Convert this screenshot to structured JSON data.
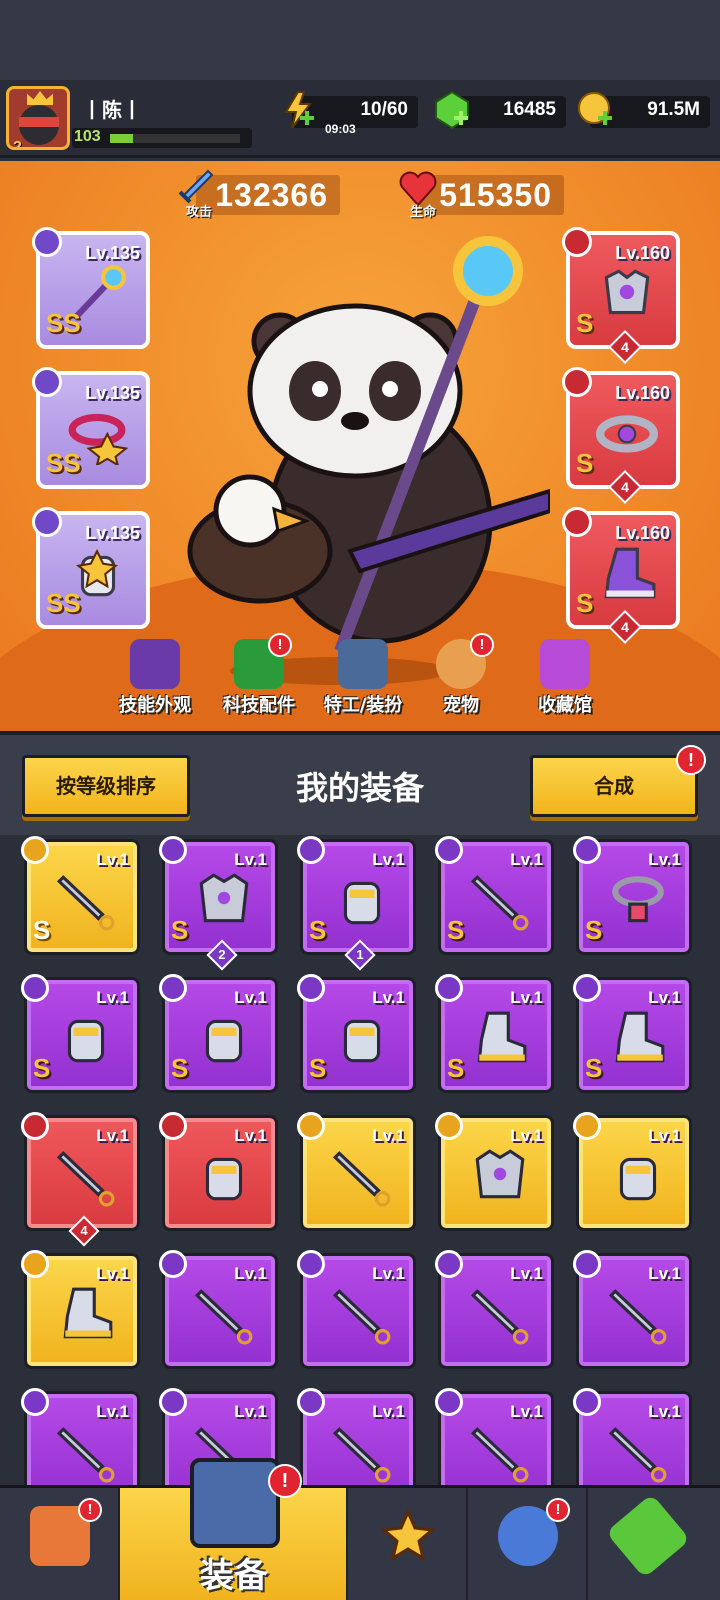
{
  "player": {
    "name": "丨陈丨",
    "level": "103",
    "avatar_level": "2"
  },
  "resources": {
    "energy": {
      "value": "10/60",
      "timer": "09:03"
    },
    "gems": {
      "value": "16485"
    },
    "coins": {
      "value": "91.5M"
    }
  },
  "stats": {
    "attack": {
      "label": "攻击",
      "value": "132366"
    },
    "health": {
      "label": "生命",
      "value": "515350"
    }
  },
  "equipped": [
    {
      "slot": "weapon",
      "level": "Lv.135",
      "grade": "SS",
      "color": "purple"
    },
    {
      "slot": "necklace",
      "level": "Lv.135",
      "grade": "SS",
      "color": "purple"
    },
    {
      "slot": "gloves",
      "level": "Lv.135",
      "grade": "SS",
      "color": "purple"
    },
    {
      "slot": "armor",
      "level": "Lv.160",
      "grade": "S",
      "color": "red",
      "stars": "4"
    },
    {
      "slot": "belt",
      "level": "Lv.160",
      "grade": "S",
      "color": "red",
      "stars": "4"
    },
    {
      "slot": "boots",
      "level": "Lv.160",
      "grade": "S",
      "color": "red",
      "stars": "4"
    }
  ],
  "features": [
    {
      "label": "技能外观",
      "alert": false
    },
    {
      "label": "科技配件",
      "alert": true
    },
    {
      "label": "特工/装扮",
      "alert": false
    },
    {
      "label": "宠物",
      "alert": true
    },
    {
      "label": "收藏馆",
      "alert": false
    }
  ],
  "inventory": {
    "title": "我的装备",
    "sort_button": "按等级排序",
    "merge_button": "合成",
    "alert_mark": "!",
    "items": [
      {
        "color": "yellow",
        "type": "weapon",
        "level": "Lv.1",
        "grade": "S"
      },
      {
        "color": "purple",
        "type": "armor",
        "level": "Lv.1",
        "grade": "S",
        "stars": "2"
      },
      {
        "color": "purple",
        "type": "gloves",
        "level": "Lv.1",
        "grade": "S",
        "stars": "1"
      },
      {
        "color": "purple",
        "type": "weapon",
        "level": "Lv.1",
        "grade": "S"
      },
      {
        "color": "purple",
        "type": "necklace",
        "level": "Lv.1",
        "grade": "S"
      },
      {
        "color": "purple",
        "type": "gloves",
        "level": "Lv.1",
        "grade": "S"
      },
      {
        "color": "purple",
        "type": "gloves",
        "level": "Lv.1",
        "grade": "S"
      },
      {
        "color": "purple",
        "type": "gloves",
        "level": "Lv.1",
        "grade": "S"
      },
      {
        "color": "purple",
        "type": "boots",
        "level": "Lv.1",
        "grade": "S"
      },
      {
        "color": "purple",
        "type": "boots",
        "level": "Lv.1",
        "grade": "S"
      },
      {
        "color": "red",
        "type": "weapon",
        "level": "Lv.1",
        "grade": "",
        "stars": "4"
      },
      {
        "color": "red",
        "type": "gloves",
        "level": "Lv.1",
        "grade": ""
      },
      {
        "color": "yellow",
        "type": "weapon",
        "level": "Lv.1",
        "grade": ""
      },
      {
        "color": "yellow",
        "type": "armor",
        "level": "Lv.1",
        "grade": ""
      },
      {
        "color": "yellow",
        "type": "gloves",
        "level": "Lv.1",
        "grade": ""
      },
      {
        "color": "yellow",
        "type": "boots",
        "level": "Lv.1",
        "grade": ""
      },
      {
        "color": "purple",
        "type": "weapon",
        "level": "Lv.1",
        "grade": ""
      },
      {
        "color": "purple",
        "type": "weapon",
        "level": "Lv.1",
        "grade": ""
      },
      {
        "color": "purple",
        "type": "weapon",
        "level": "Lv.1",
        "grade": ""
      },
      {
        "color": "purple",
        "type": "weapon",
        "level": "Lv.1",
        "grade": ""
      },
      {
        "color": "purple",
        "type": "weapon",
        "level": "Lv.1",
        "grade": ""
      },
      {
        "color": "purple",
        "type": "weapon",
        "level": "Lv.1",
        "grade": ""
      },
      {
        "color": "purple",
        "type": "weapon",
        "level": "Lv.1",
        "grade": ""
      },
      {
        "color": "purple",
        "type": "weapon",
        "level": "Lv.1",
        "grade": ""
      },
      {
        "color": "purple",
        "type": "weapon",
        "level": "Lv.1",
        "grade": ""
      }
    ]
  },
  "nav": {
    "tabs": [
      {
        "name": "shop",
        "alert": true
      },
      {
        "name": "equipment",
        "label": "装备",
        "alert": true,
        "active": true
      },
      {
        "name": "battle",
        "alert": false
      },
      {
        "name": "skills",
        "alert": true
      },
      {
        "name": "evolution",
        "alert": false
      }
    ]
  },
  "colors": {
    "accent_yellow": "#f2b41c",
    "rarity_purple": "#9230d0",
    "rarity_red": "#d83a3f",
    "hero_orange": "#f08b2a"
  }
}
